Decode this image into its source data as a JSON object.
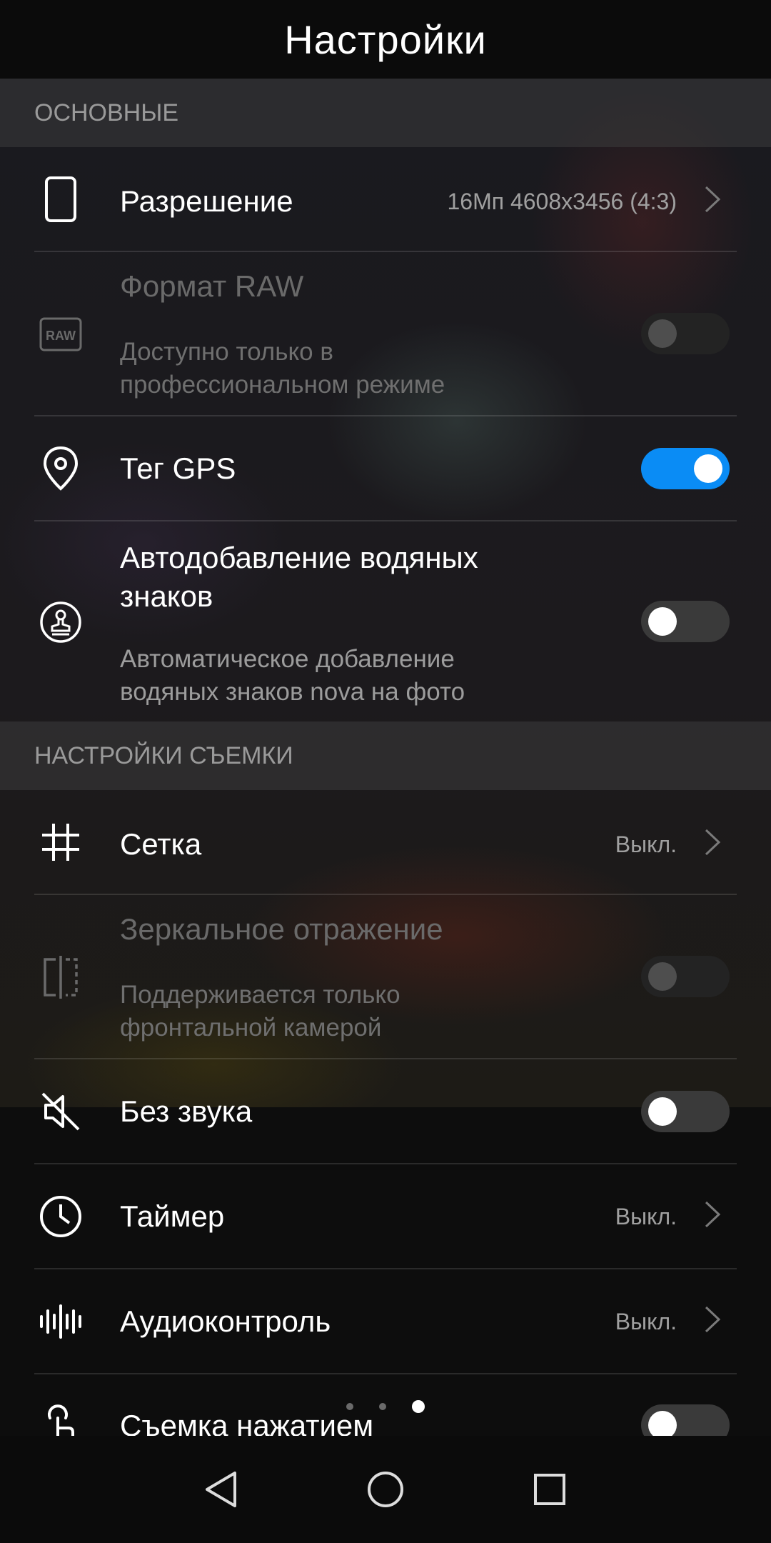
{
  "title": "Настройки",
  "sections": {
    "basic": "ОСНОВНЫЕ",
    "shooting": "НАСТРОЙКИ СЪЕМКИ"
  },
  "rows": {
    "resolution": {
      "label": "Разрешение",
      "value": "16Мп 4608x3456 (4:3)"
    },
    "raw": {
      "label": "Формат RAW",
      "sub": "Доступно только в профессиональном режиме",
      "toggle": "off-disabled"
    },
    "gps": {
      "label": "Тег GPS",
      "toggle": "on"
    },
    "watermark": {
      "label": "Автодобавление водяных знаков",
      "sub": "Автоматическое добавление водяных знаков nova на фото",
      "toggle": "off"
    },
    "grid": {
      "label": "Сетка",
      "value": "Выкл."
    },
    "mirror": {
      "label": "Зеркальное отражение",
      "sub": "Поддерживается только фронтальной камерой",
      "toggle": "off-disabled"
    },
    "mute": {
      "label": "Без звука",
      "toggle": "off"
    },
    "timer": {
      "label": "Таймер",
      "value": "Выкл."
    },
    "audio": {
      "label": "Аудиоконтроль",
      "value": "Выкл."
    },
    "touch": {
      "label": "Съемка нажатием",
      "toggle": "off"
    }
  },
  "pager": {
    "count": 3,
    "active_index": 2
  },
  "icons": {
    "resolution": "phone-outline-icon",
    "raw": "raw-icon",
    "gps": "location-pin-icon",
    "watermark": "stamp-icon",
    "grid": "grid-icon",
    "mirror": "mirror-icon",
    "mute": "speaker-mute-icon",
    "timer": "clock-icon",
    "audio": "audio-wave-icon",
    "touch": "touch-icon"
  },
  "colors": {
    "toggle_on": "#0a8cf5",
    "background": "#0d0d0d"
  }
}
